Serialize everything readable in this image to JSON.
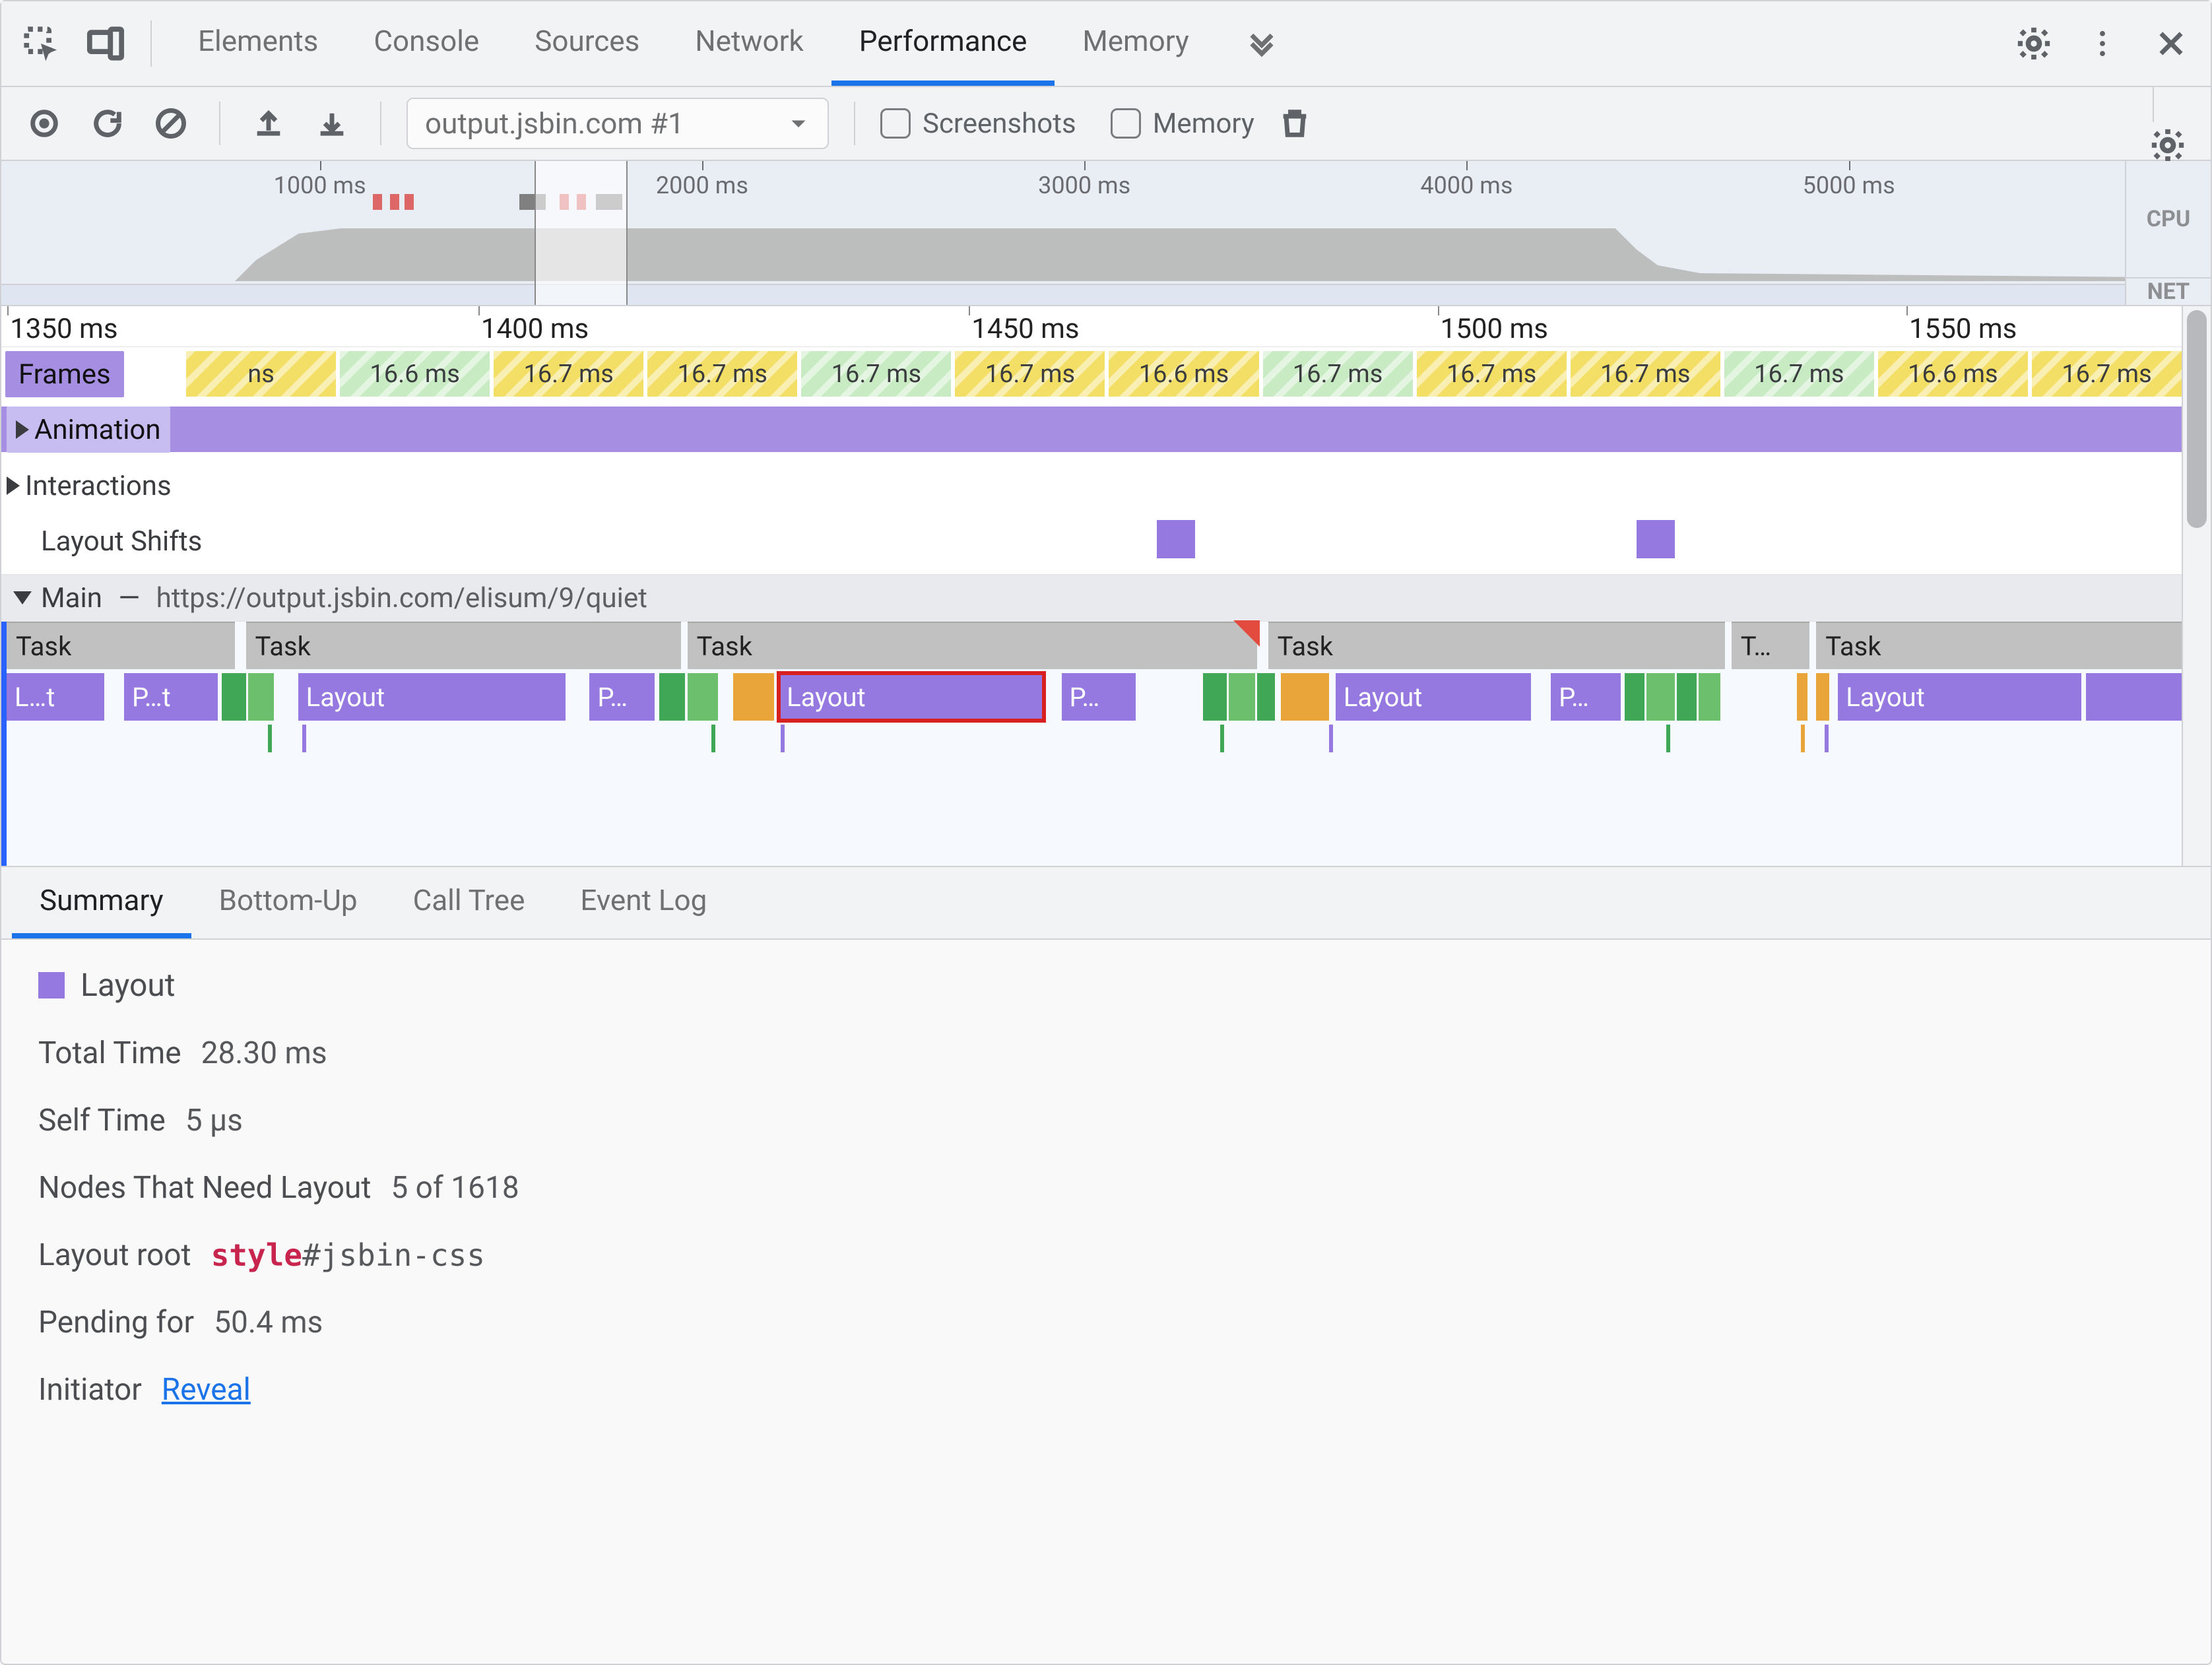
{
  "tabs": {
    "items": [
      "Elements",
      "Console",
      "Sources",
      "Network",
      "Performance",
      "Memory"
    ],
    "activeIndex": 4
  },
  "toolbar": {
    "dropdown": "output.jsbin.com #1",
    "screenshots_label": "Screenshots",
    "screenshots_checked": false,
    "memory_label": "Memory",
    "memory_checked": false
  },
  "overview": {
    "ticks": [
      "1000 ms",
      "2000 ms",
      "3000 ms",
      "4000 ms",
      "5000 ms"
    ],
    "gutter": {
      "cpu": "CPU",
      "net": "NET"
    },
    "window": {
      "left_pct": 25.1,
      "width_pct": 4.4
    }
  },
  "ruler": {
    "ticks": [
      {
        "label": "1350 ms",
        "left_pct": 0
      },
      {
        "label": "1400 ms",
        "left_pct": 22
      },
      {
        "label": "1450 ms",
        "left_pct": 44.5
      },
      {
        "label": "1500 ms",
        "left_pct": 66
      },
      {
        "label": "1550 ms",
        "left_pct": 87.5
      }
    ]
  },
  "lanes": {
    "frames": {
      "label": "Frames",
      "cells": [
        {
          "label": "ns",
          "style": "y"
        },
        {
          "label": "16.6 ms",
          "style": "g"
        },
        {
          "label": "16.7 ms",
          "style": "y"
        },
        {
          "label": "16.7 ms",
          "style": "y"
        },
        {
          "label": "16.7 ms",
          "style": "g"
        },
        {
          "label": "16.7 ms",
          "style": "y"
        },
        {
          "label": "16.6 ms",
          "style": "y"
        },
        {
          "label": "16.7 ms",
          "style": "g"
        },
        {
          "label": "16.7 ms",
          "style": "y"
        },
        {
          "label": "16.7 ms",
          "style": "y"
        },
        {
          "label": "16.7 ms",
          "style": "g"
        },
        {
          "label": "16.6 ms",
          "style": "y"
        },
        {
          "label": "16.7 ms",
          "style": "y"
        }
      ]
    },
    "animation": {
      "label": "Animation"
    },
    "interactions": {
      "label": "Interactions"
    },
    "layout_shifts": {
      "label": "Layout Shifts",
      "blocks": [
        {
          "left_pct": 53
        },
        {
          "left_pct": 75
        }
      ]
    },
    "main": {
      "label": "Main",
      "url": "https://output.jsbin.com/elisum/9/quiet",
      "tasks": [
        {
          "label": "Task",
          "left_pct": 0,
          "width_pct": 10.5
        },
        {
          "label": "Task",
          "left_pct": 11,
          "width_pct": 20
        },
        {
          "label": "Task",
          "left_pct": 31.3,
          "width_pct": 26.2,
          "long": true
        },
        {
          "label": "Task",
          "left_pct": 58,
          "width_pct": 21
        },
        {
          "label": "T…",
          "left_pct": 79.3,
          "width_pct": 3.6
        },
        {
          "label": "Task",
          "left_pct": 83.2,
          "width_pct": 16.8
        }
      ],
      "work": [
        {
          "label": "L…t",
          "type": "purple",
          "left_pct": 0,
          "width_pct": 4.5
        },
        {
          "label": "P…t",
          "type": "purple",
          "left_pct": 5.4,
          "width_pct": 4.3
        },
        {
          "label": "",
          "type": "green",
          "left_pct": 9.9,
          "width_pct": 1.1
        },
        {
          "label": "",
          "type": "dgreen",
          "left_pct": 11.1,
          "width_pct": 1.2
        },
        {
          "label": "Layout",
          "type": "purple",
          "left_pct": 13.4,
          "width_pct": 12.3
        },
        {
          "label": "P…",
          "type": "purple",
          "left_pct": 26.8,
          "width_pct": 3.0
        },
        {
          "label": "",
          "type": "green",
          "left_pct": 30.0,
          "width_pct": 1.2
        },
        {
          "label": "",
          "type": "dgreen",
          "left_pct": 31.3,
          "width_pct": 1.4
        },
        {
          "label": "",
          "type": "orange",
          "left_pct": 33.4,
          "width_pct": 1.9
        },
        {
          "label": "Layout",
          "type": "purple",
          "left_pct": 35.5,
          "width_pct": 12.2,
          "selected": true
        },
        {
          "label": "P…",
          "type": "purple",
          "left_pct": 48.5,
          "width_pct": 3.4
        },
        {
          "label": "",
          "type": "green",
          "left_pct": 55.0,
          "width_pct": 1.1
        },
        {
          "label": "",
          "type": "dgreen",
          "left_pct": 56.2,
          "width_pct": 1.2
        },
        {
          "label": "",
          "type": "green",
          "left_pct": 57.5,
          "width_pct": 0.8
        },
        {
          "label": "",
          "type": "orange",
          "left_pct": 58.6,
          "width_pct": 2.2
        },
        {
          "label": "Layout",
          "type": "purple",
          "left_pct": 61.1,
          "width_pct": 9.0
        },
        {
          "label": "P…",
          "type": "purple",
          "left_pct": 71.0,
          "width_pct": 3.2
        },
        {
          "label": "",
          "type": "green",
          "left_pct": 74.4,
          "width_pct": 0.9
        },
        {
          "label": "",
          "type": "dgreen",
          "left_pct": 75.4,
          "width_pct": 1.3
        },
        {
          "label": "",
          "type": "green",
          "left_pct": 76.8,
          "width_pct": 0.9
        },
        {
          "label": "",
          "type": "dgreen",
          "left_pct": 77.8,
          "width_pct": 1.0
        },
        {
          "label": "",
          "type": "orange",
          "left_pct": 82.3,
          "width_pct": 0.5
        },
        {
          "label": "",
          "type": "orange",
          "left_pct": 83.2,
          "width_pct": 0.6
        },
        {
          "label": "Layout",
          "type": "purple",
          "left_pct": 84.2,
          "width_pct": 11.2
        },
        {
          "label": "",
          "type": "purple",
          "left_pct": 95.6,
          "width_pct": 4.4
        }
      ],
      "stubs": [
        {
          "type": "g",
          "left_pct": 12.0
        },
        {
          "type": "p",
          "left_pct": 13.6
        },
        {
          "type": "g",
          "left_pct": 32.4
        },
        {
          "type": "p",
          "left_pct": 35.6
        },
        {
          "type": "g",
          "left_pct": 55.8
        },
        {
          "type": "p",
          "left_pct": 60.8
        },
        {
          "type": "g",
          "left_pct": 76.3
        },
        {
          "type": "o",
          "left_pct": 82.5
        },
        {
          "type": "p",
          "left_pct": 83.6
        }
      ]
    }
  },
  "detail_tabs": {
    "items": [
      "Summary",
      "Bottom-Up",
      "Call Tree",
      "Event Log"
    ],
    "activeIndex": 0
  },
  "summary": {
    "title": "Layout",
    "rows": [
      {
        "k": "Total Time",
        "v": "28.30 ms"
      },
      {
        "k": "Self Time",
        "v": "5 µs"
      },
      {
        "k": "Nodes That Need Layout",
        "v": "5 of 1618"
      }
    ],
    "layout_root": {
      "k": "Layout root",
      "tag": "style",
      "sel": "#jsbin-css"
    },
    "pending": {
      "k": "Pending for",
      "v": "50.4 ms"
    },
    "initiator": {
      "k": "Initiator",
      "link": "Reveal"
    }
  }
}
